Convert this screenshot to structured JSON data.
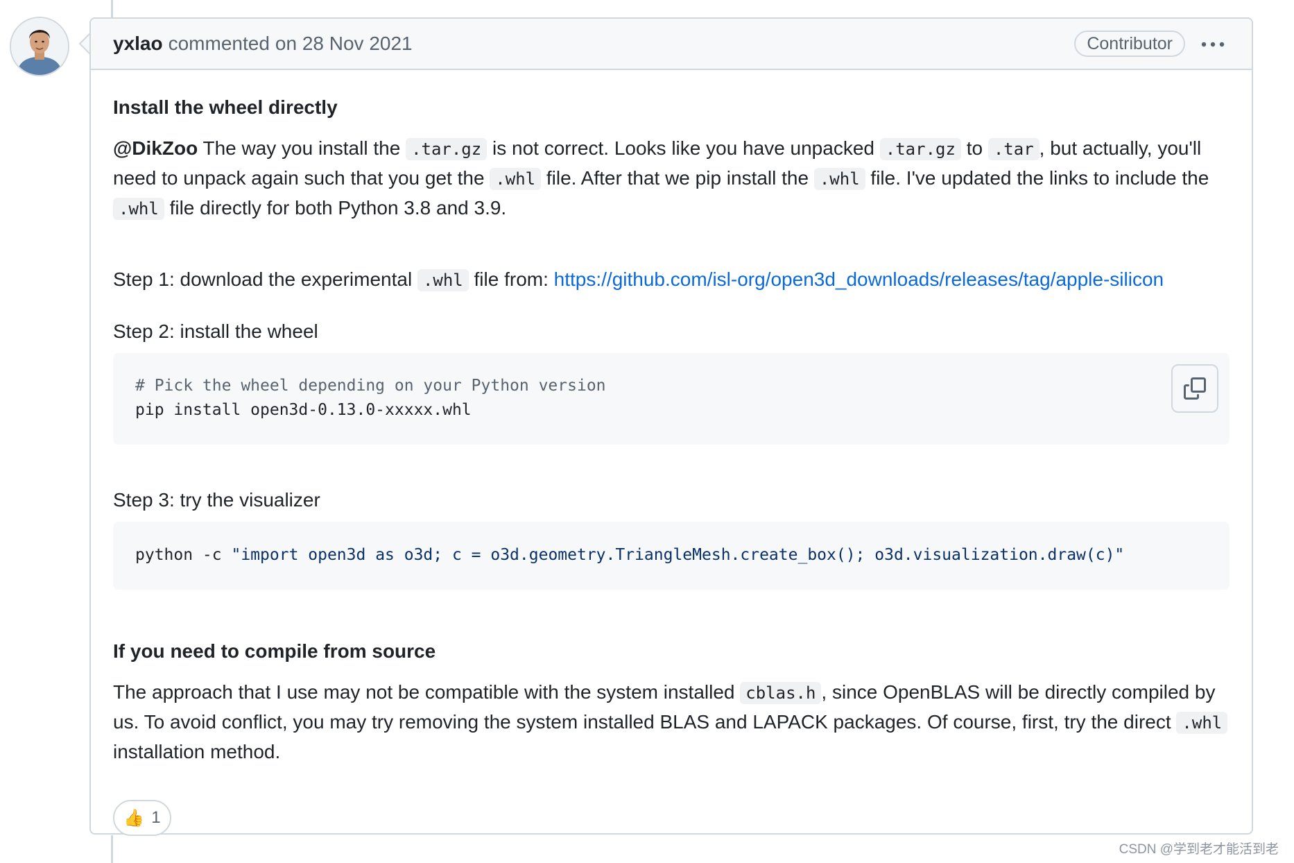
{
  "comment": {
    "author": "yxlao",
    "commented_word": "commented",
    "date_text": "on 28 Nov 2021",
    "role_badge": "Contributor",
    "colors": {
      "link": "#0969da",
      "border": "#d0d7de",
      "header_bg": "#f6f8fa"
    }
  },
  "body": {
    "heading1": "Install the wheel directly",
    "p1": {
      "mention": "@DikZoo",
      "t1": " The way you install the ",
      "c1": ".tar.gz",
      "t2": " is not correct. Looks like you have unpacked ",
      "c2": ".tar.gz",
      "t3": " to ",
      "c3": ".tar",
      "t4": ", but actually, you'll need to unpack again such that you get the ",
      "c4": ".whl",
      "t5": " file. After that we pip install the ",
      "c5": ".whl",
      "t6": " file. I've updated the links to include the ",
      "c6": ".whl",
      "t7": " file directly for both Python 3.8 and 3.9."
    },
    "step1": {
      "t1": "Step 1: download the experimental ",
      "c1": ".whl",
      "t2": " file from: ",
      "link": "https://github.com/isl-org/open3d_downloads/releases/tag/apple-silicon"
    },
    "step2": "Step 2: install the wheel",
    "code1": {
      "comment": "# Pick the wheel depending on your Python version",
      "line2": "pip install open3d-0.13.0-xxxxx.whl"
    },
    "step3": "Step 3: try the visualizer",
    "code2": {
      "cmd": "python -c ",
      "str": "\"import open3d as o3d; c = o3d.geometry.TriangleMesh.create_box(); o3d.visualization.draw(c)\""
    },
    "heading2": "If you need to compile from source",
    "p2": {
      "t1": "The approach that I use may not be compatible with the system installed ",
      "c1": "cblas.h",
      "t2": ", since OpenBLAS will be directly compiled by us. To avoid conflict, you may try removing the system installed BLAS and LAPACK packages. Of course, first, try the direct ",
      "c2": ".whl",
      "t3": " installation method."
    }
  },
  "reaction": {
    "emoji": "👍",
    "count": "1"
  },
  "watermark": "CSDN @学到老才能活到老",
  "icons": {
    "copy": "copy-icon",
    "more": "kebab-horizontal-icon",
    "avatar": "user-avatar"
  }
}
